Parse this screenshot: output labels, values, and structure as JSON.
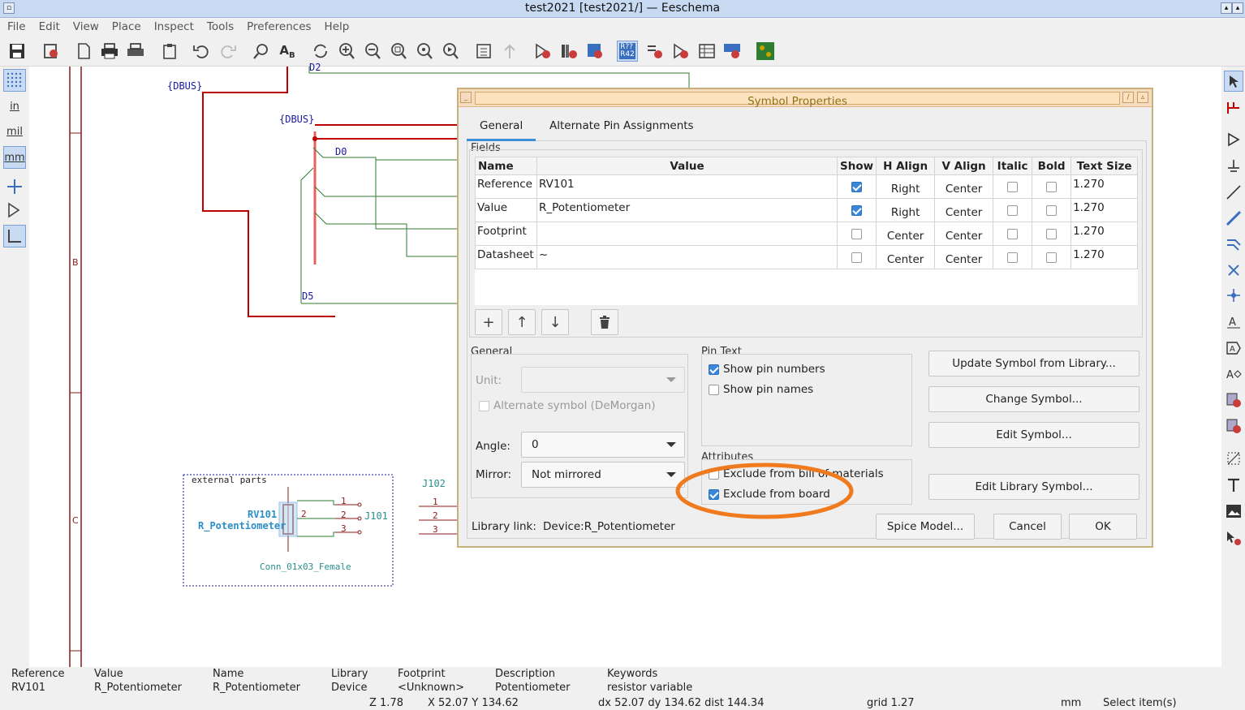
{
  "window": {
    "title": "test2021 [test2021/] — Eeschema"
  },
  "menu": [
    "File",
    "Edit",
    "View",
    "Place",
    "Inspect",
    "Tools",
    "Preferences",
    "Help"
  ],
  "left_toolbar": {
    "in_label": "in",
    "mil_label": "mil",
    "mm_label": "mm"
  },
  "canvas": {
    "labels": {
      "dbus1": "{DBUS}",
      "dbus2": "{DBUS}",
      "d0": "D0",
      "d2": "D2",
      "d5": "D5",
      "border_b": "B",
      "border_c": "C",
      "j102": "J102",
      "j101": "J101",
      "rv101": "RV101",
      "r_pot": "R_Potentiometer",
      "conn": "Conn_01x03_Female",
      "ext_parts": "external parts",
      "pin1": "1",
      "pin2": "2",
      "pin3": "3",
      "pin2b": "2",
      "pin1r": "1",
      "pin2r": "2",
      "pin3r": "3"
    }
  },
  "dialog": {
    "title": "Symbol Properties",
    "tabs": [
      "General",
      "Alternate Pin Assignments"
    ],
    "fields_label": "Fields",
    "columns": [
      "Name",
      "Value",
      "Show",
      "H Align",
      "V Align",
      "Italic",
      "Bold",
      "Text Size"
    ],
    "rows": [
      {
        "name": "Reference",
        "value": "RV101",
        "show": true,
        "halign": "Right",
        "valign": "Center",
        "italic": false,
        "bold": false,
        "size": "1.270"
      },
      {
        "name": "Value",
        "value": "R_Potentiometer",
        "show": true,
        "halign": "Right",
        "valign": "Center",
        "italic": false,
        "bold": false,
        "size": "1.270"
      },
      {
        "name": "Footprint",
        "value": "",
        "show": false,
        "halign": "Center",
        "valign": "Center",
        "italic": false,
        "bold": false,
        "size": "1.270"
      },
      {
        "name": "Datasheet",
        "value": "~",
        "show": false,
        "halign": "Center",
        "valign": "Center",
        "italic": false,
        "bold": false,
        "size": "1.270"
      }
    ],
    "general": {
      "label": "General",
      "unit_label": "Unit:",
      "alt_symbol": "Alternate symbol (DeMorgan)",
      "angle_label": "Angle:",
      "angle_value": "0",
      "mirror_label": "Mirror:",
      "mirror_value": "Not mirrored"
    },
    "pin_text": {
      "label": "Pin Text",
      "show_numbers": "Show pin numbers",
      "show_names": "Show pin names"
    },
    "attributes": {
      "label": "Attributes",
      "exclude_bom": "Exclude from bill of materials",
      "exclude_board": "Exclude from board"
    },
    "buttons": {
      "update": "Update Symbol from Library...",
      "change": "Change Symbol...",
      "edit": "Edit Symbol...",
      "edit_lib": "Edit Library Symbol...",
      "spice": "Spice Model...",
      "cancel": "Cancel",
      "ok": "OK"
    },
    "library_link": {
      "label": "Library link:",
      "value": "Device:R_Potentiometer"
    },
    "highlight_color": "#f07a1e"
  },
  "info": {
    "cols": [
      {
        "h": "Reference",
        "v": "RV101"
      },
      {
        "h": "Value",
        "v": "R_Potentiometer"
      },
      {
        "h": "Name",
        "v": "R_Potentiometer"
      },
      {
        "h": "Library",
        "v": "Device"
      },
      {
        "h": "Footprint",
        "v": "<Unknown>"
      },
      {
        "h": "Description",
        "v": "Potentiometer"
      },
      {
        "h": "Keywords",
        "v": "resistor variable"
      }
    ],
    "status": {
      "zoom": "Z 1.78",
      "xy": "X 52.07  Y 134.62",
      "dxy": "dx 52.07  dy 134.62  dist 144.34",
      "grid": "grid 1.27",
      "units": "mm",
      "mode": "Select item(s)"
    }
  }
}
